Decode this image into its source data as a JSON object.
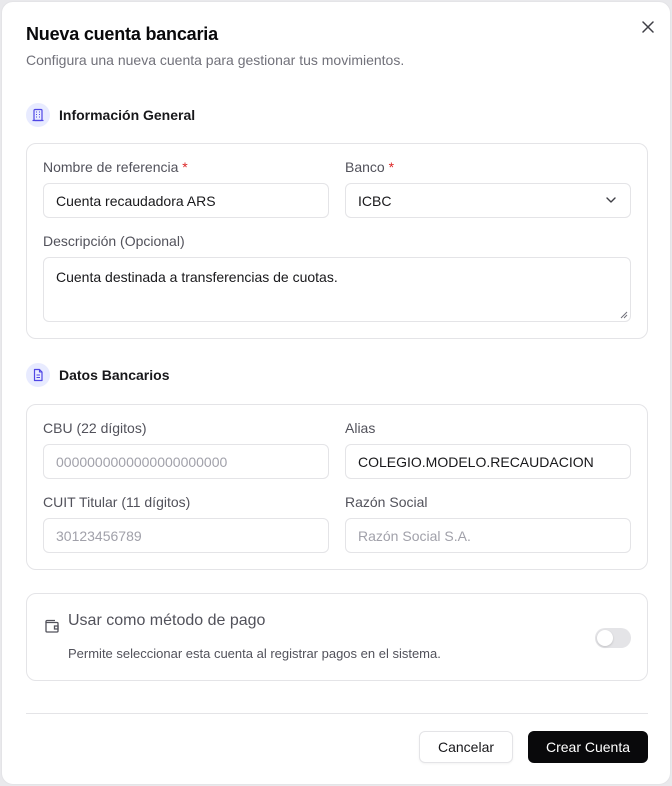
{
  "dialog": {
    "title": "Nueva cuenta bancaria",
    "subtitle": "Configura una nueva cuenta para gestionar tus movimientos."
  },
  "general": {
    "section_title": "Información General",
    "icon": "building-icon",
    "name_label": "Nombre de referencia",
    "name_value": "Cuenta recaudadora ARS",
    "bank_label": "Banco",
    "bank_value": "ICBC",
    "required_mark": "*",
    "description_label": "Descripción (Opcional)",
    "description_value": "Cuenta destinada a transferencias de cuotas."
  },
  "bank_data": {
    "section_title": "Datos Bancarios",
    "icon": "document-icon",
    "cbu_label": "CBU (22 dígitos)",
    "cbu_placeholder": "0000000000000000000000",
    "alias_label": "Alias",
    "alias_value": "COLEGIO.MODELO.RECAUDACION",
    "cuit_label": "CUIT Titular (11 dígitos)",
    "cuit_placeholder": "30123456789",
    "business_label": "Razón Social",
    "business_placeholder": "Razón Social S.A."
  },
  "payment_method": {
    "title": "Usar como método de pago",
    "description": "Permite seleccionar esta cuenta al registrar pagos en el sistema.",
    "enabled": false
  },
  "footer": {
    "cancel_label": "Cancelar",
    "create_label": "Crear Cuenta"
  },
  "colors": {
    "accent_icon_bg": "#e8ebff",
    "accent_icon": "#4f46e5",
    "required": "#dc2626",
    "primary_button": "#09090b"
  }
}
